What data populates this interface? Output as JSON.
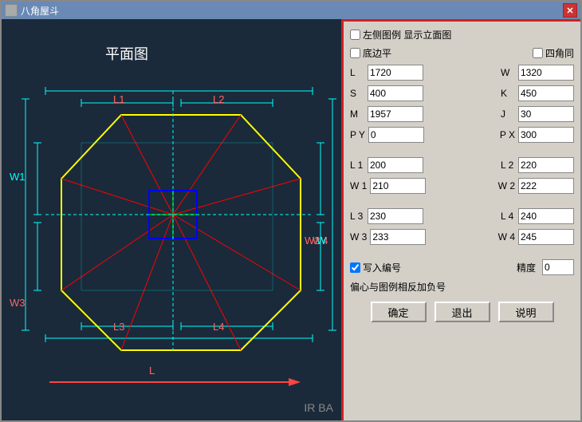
{
  "window": {
    "title": "八角屋斗",
    "close_label": "✕"
  },
  "panel": {
    "checkbox_left_label": "左侧图例 显示立面图",
    "checkbox_bottom_label": "底边平",
    "checkbox_four_label": "四角同",
    "fields": {
      "L": "1720",
      "W": "1320",
      "S": "400",
      "K": "450",
      "M": "1957",
      "J": "30",
      "PY": "0",
      "PX": "300",
      "L1": "200",
      "L2": "220",
      "W1": "210",
      "W2": "222",
      "L3": "230",
      "L4": "240",
      "W3": "233",
      "W4": "245"
    },
    "write_number_label": "写入编号",
    "precision_label": "精度",
    "precision_value": "0",
    "offset_label": "偏心与图例相反加负号",
    "btn_ok": "确定",
    "btn_exit": "退出",
    "btn_help": "说明"
  },
  "cad": {
    "plan_title": "平面图",
    "labels": {
      "L1": "L1",
      "L2": "L2",
      "L3": "L3",
      "L4": "L4",
      "W1": "W1",
      "W2": "W2",
      "W3": "W3",
      "W4": "W4",
      "W": "W",
      "L": "L"
    }
  },
  "watermark": {
    "text": "IR BA"
  }
}
